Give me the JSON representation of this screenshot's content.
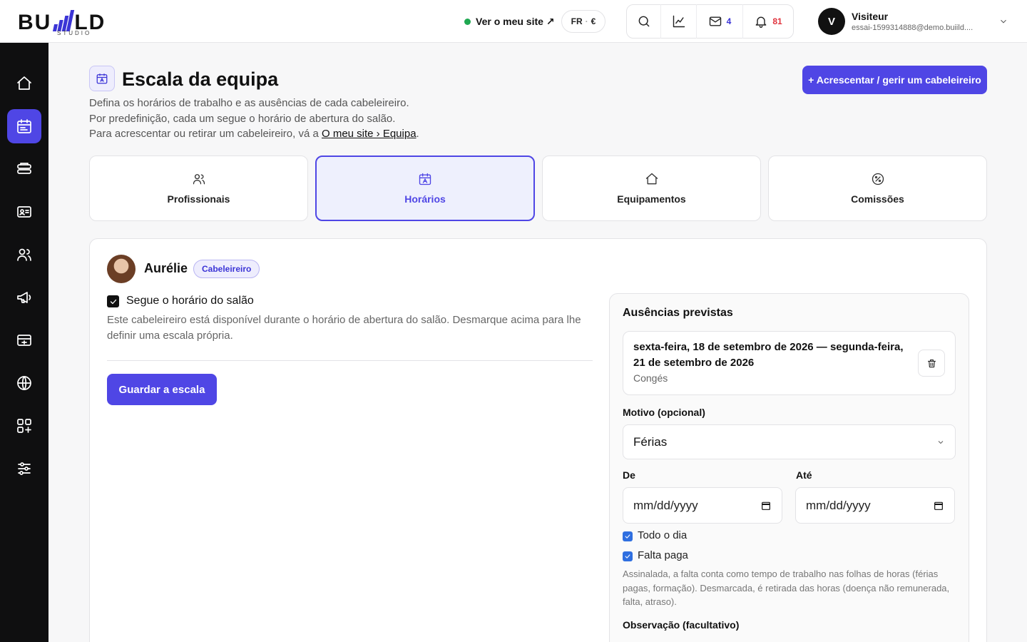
{
  "brand": {
    "main_left": "BU",
    "main_right": "LD",
    "sub": "STUDIO",
    "accent": "#4f46e5"
  },
  "topbar": {
    "site_link": "Ver o meu site ↗",
    "lang": "FR",
    "currency": "€",
    "messages_count": "4",
    "notifications_count": "81"
  },
  "user": {
    "initial": "V",
    "name": "Visiteur",
    "email": "essai-1599314888@demo.buiild...."
  },
  "sidebar": {
    "items": [
      {
        "icon": "home-icon",
        "active": false
      },
      {
        "icon": "calendar-icon",
        "active": true
      },
      {
        "icon": "stack-icon",
        "active": false
      },
      {
        "icon": "id-card-icon",
        "active": false
      },
      {
        "icon": "users-icon",
        "active": false
      },
      {
        "icon": "megaphone-icon",
        "active": false
      },
      {
        "icon": "register-icon",
        "active": false
      },
      {
        "icon": "globe-icon",
        "active": false
      },
      {
        "icon": "grid-plus-icon",
        "active": false
      },
      {
        "icon": "sliders-icon",
        "active": false
      }
    ]
  },
  "header": {
    "title": "Escala da equipa",
    "desc_line1": "Defina os horários de trabalho e as ausências de cada cabeleireiro.",
    "desc_line2": "Por predefinição, cada um segue o horário de abertura do salão.",
    "desc_line3_prefix": "Para acrescentar ou retirar um cabeleireiro, vá a ",
    "desc_link": "O meu site › Equipa",
    "desc_line3_suffix": ".",
    "add_button": "+ Acrescentar / gerir um cabeleireiro"
  },
  "tabs": [
    {
      "label": "Profissionais",
      "icon": "users-icon",
      "active": false
    },
    {
      "label": "Horários",
      "icon": "calendar-icon",
      "active": true
    },
    {
      "label": "Equipamentos",
      "icon": "home-icon",
      "active": false
    },
    {
      "label": "Comissões",
      "icon": "percent-icon",
      "active": false
    }
  ],
  "professional": {
    "name": "Aurélie",
    "role": "Cabeleireiro",
    "follow_hours_label": "Segue o horário do salão",
    "follow_hours_checked": true,
    "follow_hours_help": "Este cabeleireiro está disponível durante o horário de abertura do salão. Desmarque acima para lhe definir uma escala própria.",
    "save_button": "Guardar a escala"
  },
  "absences": {
    "title": "Ausências previstas",
    "items": [
      {
        "dates": "sexta-feira, 18 de setembro de 2026 — segunda-feira, 21 de setembro de 2026",
        "reason": "Congés"
      }
    ],
    "reason_label": "Motivo (opcional)",
    "reason_value": "Férias",
    "from_label": "De",
    "to_label": "Até",
    "date_placeholder": "mm/dd/yyyy",
    "all_day_label": "Todo o dia",
    "all_day_checked": true,
    "paid_label": "Falta paga",
    "paid_checked": true,
    "paid_help": "Assinalada, a falta conta como tempo de trabalho nas folhas de horas (férias pagas, formação). Desmarcada, é retirada das horas (doença não remunerada, falta, atraso).",
    "note_label": "Observação (facultativo)"
  }
}
